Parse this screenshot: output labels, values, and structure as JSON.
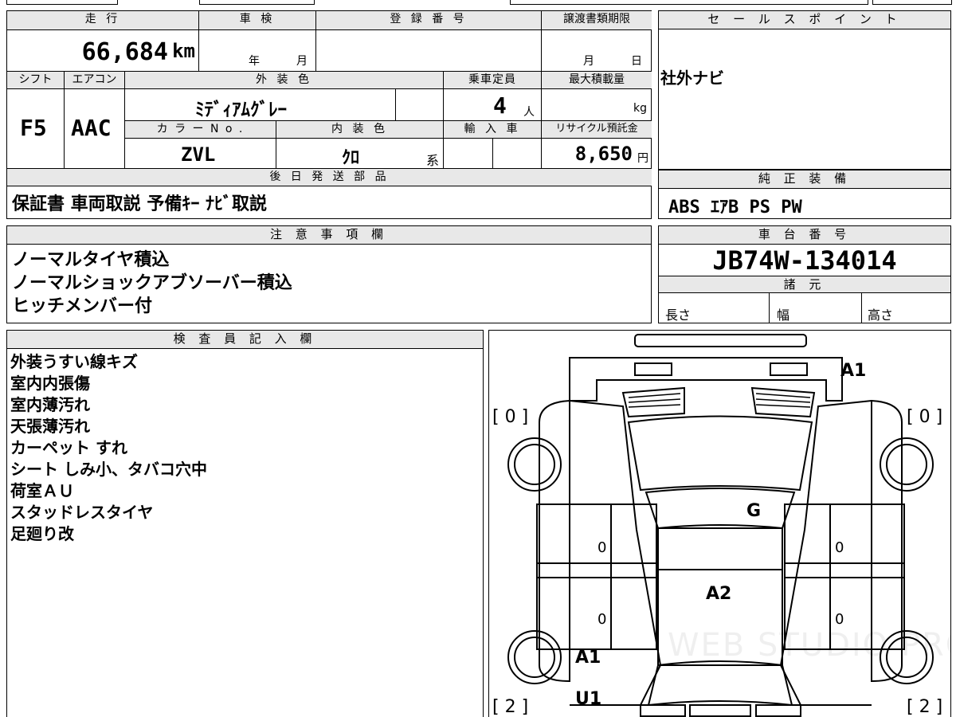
{
  "top_info": {
    "mileage_label": "走 行",
    "mileage_value": "66,684",
    "mileage_unit": "km",
    "inspection_label": "車 検",
    "year_unit": "年",
    "month_unit": "月",
    "registration_label": "登 録 番 号",
    "transfer_label": "譲渡書類期限",
    "transfer_month": "月",
    "transfer_day": "日",
    "shift_label": "シフト",
    "shift_value": "F5",
    "ac_label": "エアコン",
    "ac_value": "AAC",
    "exterior_label": "外 装 色",
    "exterior_value": "ﾐﾃﾞｨｱﾑｸﾞﾚｰ",
    "capacity_label": "乗車定員",
    "capacity_value": "4",
    "capacity_unit": "人",
    "max_load_label": "最大積載量",
    "max_load_unit": "kg",
    "color_no_label": "カ ラ ー N o .",
    "color_no_value": "ZVL",
    "interior_label": "内 装 色",
    "interior_value": "ｸﾛ",
    "interior_unit": "系",
    "import_label": "輸 入 車",
    "recycle_label": "リサイクル預託金",
    "recycle_value": "8,650",
    "recycle_unit": "円"
  },
  "later_parts": {
    "label": "後 日 発 送 部 品",
    "value": "保証書 車両取説 予備ｷｰ ﾅﾋﾞ取説"
  },
  "sales_point": {
    "label": "セ ー ル ス ポ イ ン ト",
    "value": "社外ナビ"
  },
  "genuine_equipment": {
    "label": "純 正 装 備",
    "value": "ABS ｴｱB PS PW"
  },
  "notes": {
    "label": "注 意 事 項 欄",
    "lines": [
      "ノーマルタイヤ積込",
      "ノーマルショックアブソーバー積込",
      "ヒッチメンバー付"
    ]
  },
  "chassis": {
    "label": "車 台 番 号",
    "value": "JB74W-134014"
  },
  "specs": {
    "label": "諸 元",
    "length_label": "長さ",
    "width_label": "幅",
    "height_label": "高さ"
  },
  "inspector": {
    "label": "検 査 員 記 入 欄",
    "lines": [
      "外装うすい線キズ",
      "室内内張傷",
      "室内薄汚れ",
      "天張薄汚れ",
      "カーペット すれ",
      "シート しみ小、タバコ穴中",
      "荷室ＡＵ",
      "スタッドレスタイヤ",
      "足廻り改"
    ]
  },
  "diagram": {
    "tire_fl": "[ 0 ]",
    "tire_fr": "[ 0 ]",
    "tire_rl": "[ 2 ]",
    "tire_rr": "[ 2 ]",
    "mark_front_bumper": "A1",
    "mark_roof": "G",
    "mark_center": "A2",
    "mark_rear_left_a": "A1",
    "mark_rear_left_u": "U1",
    "door_fl": "0",
    "door_fr": "0",
    "door_rl": "0",
    "door_rr": "0",
    "watermark": "WEB STUDIO PRO"
  }
}
